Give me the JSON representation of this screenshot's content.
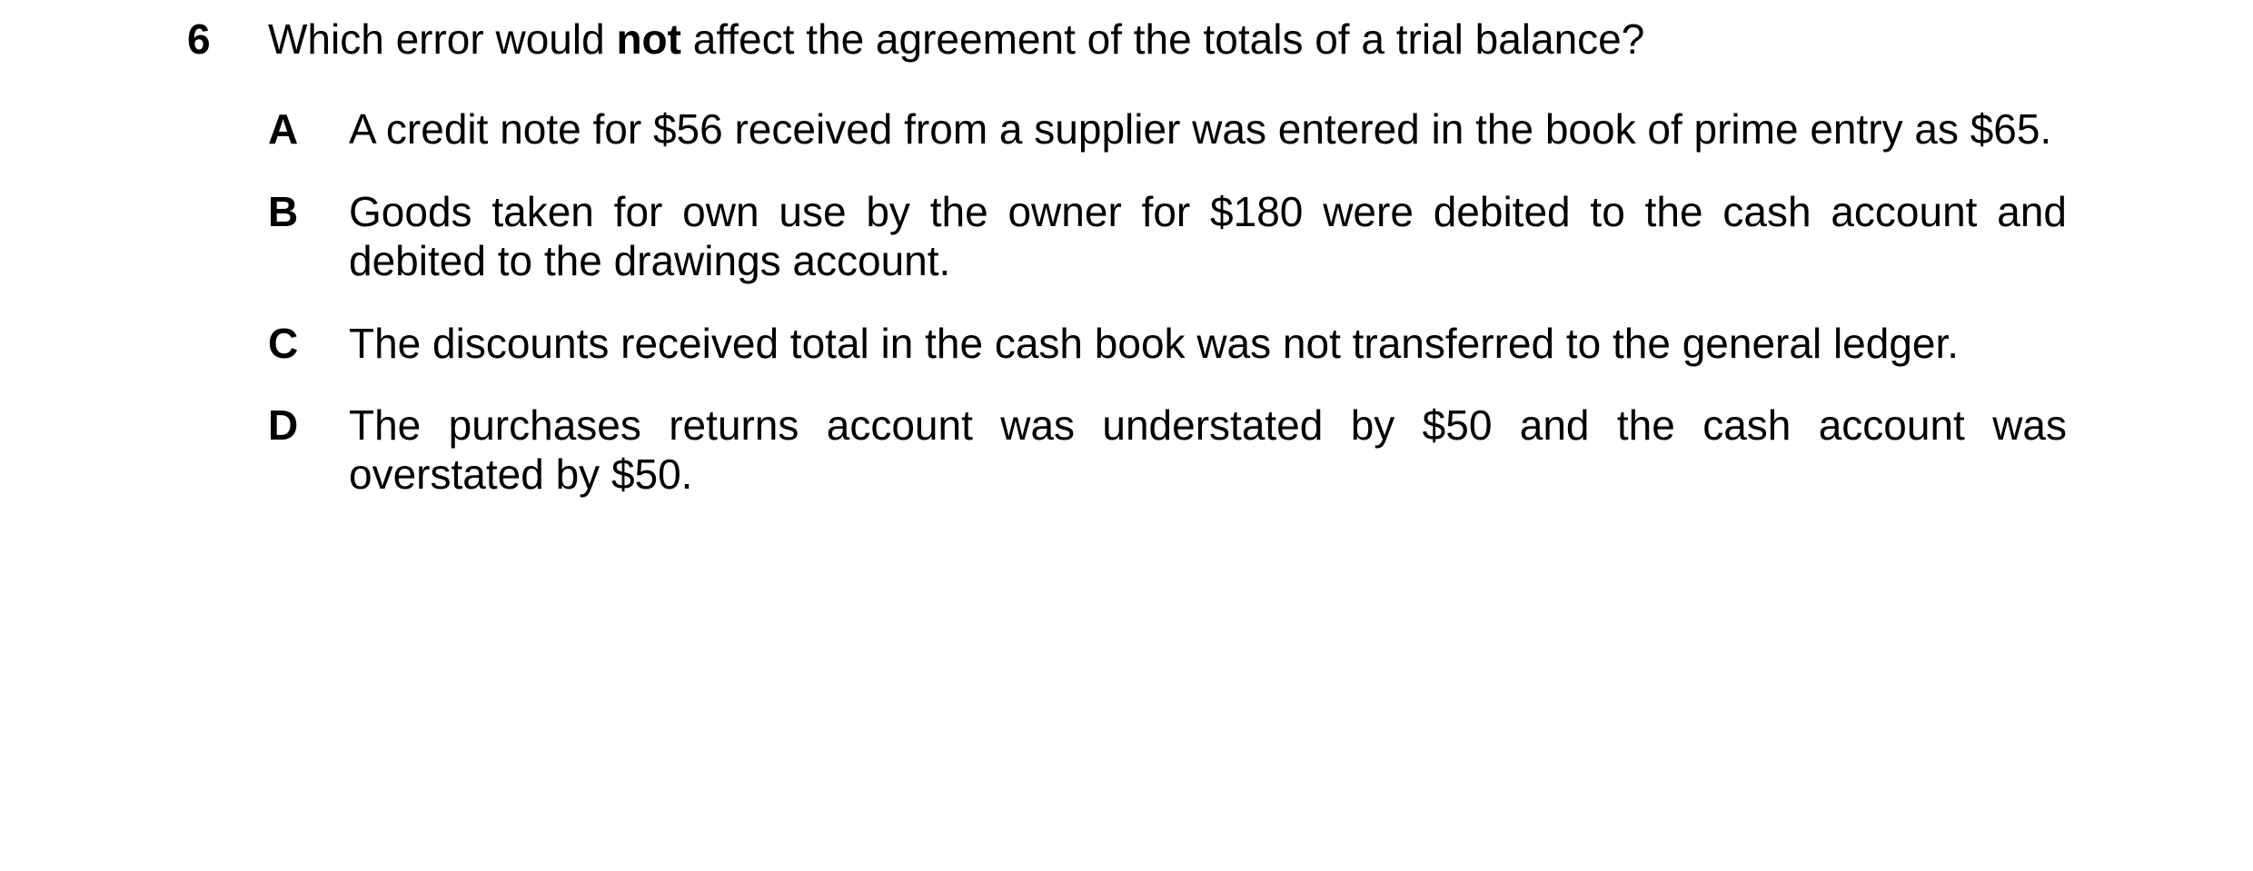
{
  "question": {
    "number": "6",
    "stem_before": "Which error would ",
    "stem_emphasis": "not",
    "stem_after": " affect the agreement of the totals of a trial balance?",
    "options": [
      {
        "letter": "A",
        "text": "A credit note for $56 received from a supplier was entered in the book of prime entry as $65."
      },
      {
        "letter": "B",
        "text": "Goods taken for own use by the owner for $180 were debited to the cash account and debited to the drawings account."
      },
      {
        "letter": "C",
        "text": "The discounts received total in the cash book was not transferred to the general ledger."
      },
      {
        "letter": "D",
        "text": "The purchases returns account was understated by $50 and the cash account was overstated by $50."
      }
    ]
  }
}
